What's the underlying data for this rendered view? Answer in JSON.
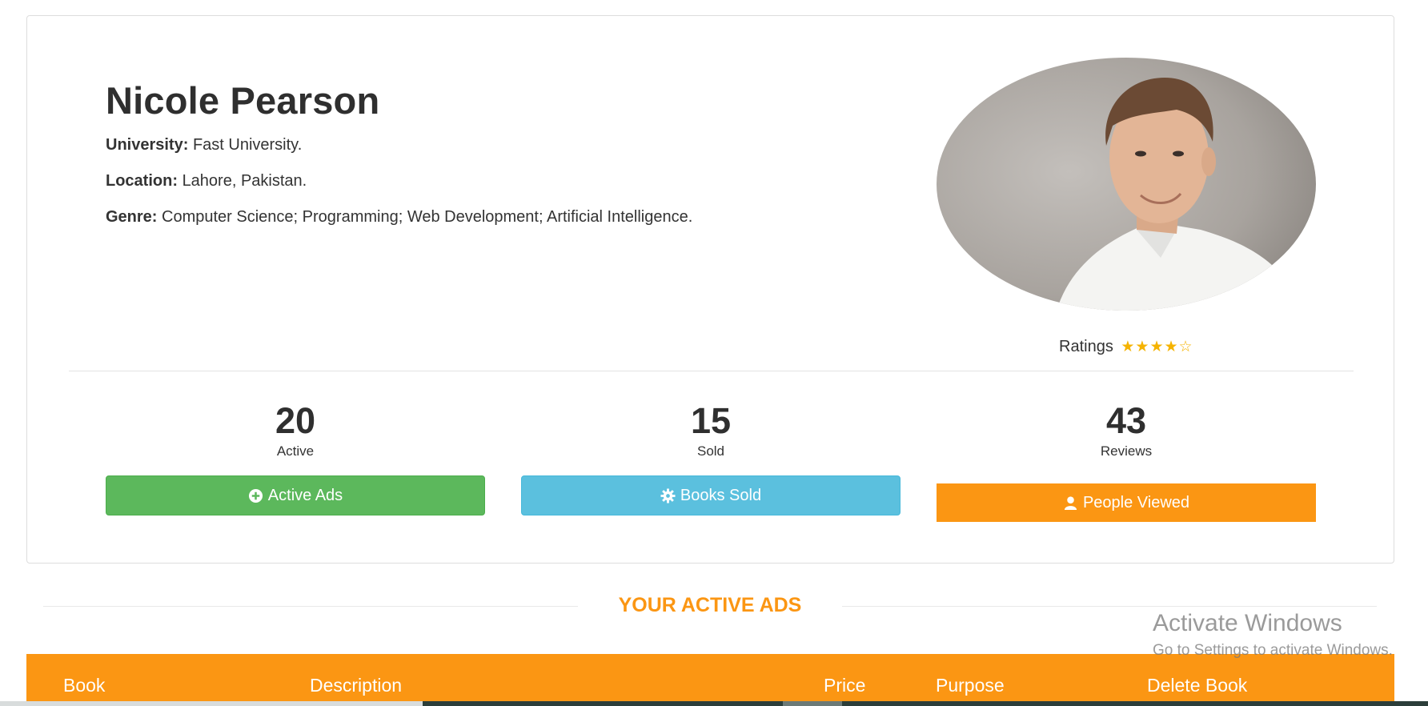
{
  "profile": {
    "name": "Nicole Pearson",
    "university_label": "University:",
    "university_value": "Fast University.",
    "location_label": "Location:",
    "location_value": "Lahore, Pakistan.",
    "genre_label": "Genre:",
    "genre_value": "Computer Science; Programming; Web Development; Artificial Intelligence.",
    "ratings_label": "Ratings",
    "rating": 4,
    "rating_max": 5,
    "stars": "★★★★☆"
  },
  "stats": [
    {
      "value": "20",
      "label": "Active",
      "button_label": "Active Ads",
      "button_icon": "plus-circle-icon",
      "color": "#5cb85c"
    },
    {
      "value": "15",
      "label": "Sold",
      "button_label": "Books Sold",
      "button_icon": "gear-icon",
      "color": "#5bc0de"
    },
    {
      "value": "43",
      "label": "Reviews",
      "button_label": "People Viewed",
      "button_icon": "user-icon",
      "color": "#fb9613"
    }
  ],
  "section": {
    "title": "YOUR ACTIVE ADS"
  },
  "table": {
    "headers": [
      "Book",
      "Description",
      "Price",
      "Purpose",
      "Delete Book"
    ]
  },
  "watermark": {
    "line1": "Activate Windows",
    "line2": "Go to Settings to activate Windows."
  },
  "colors": {
    "accent": "#fb9613",
    "success": "#5cb85c",
    "info": "#5bc0de",
    "star": "#f5b301"
  }
}
